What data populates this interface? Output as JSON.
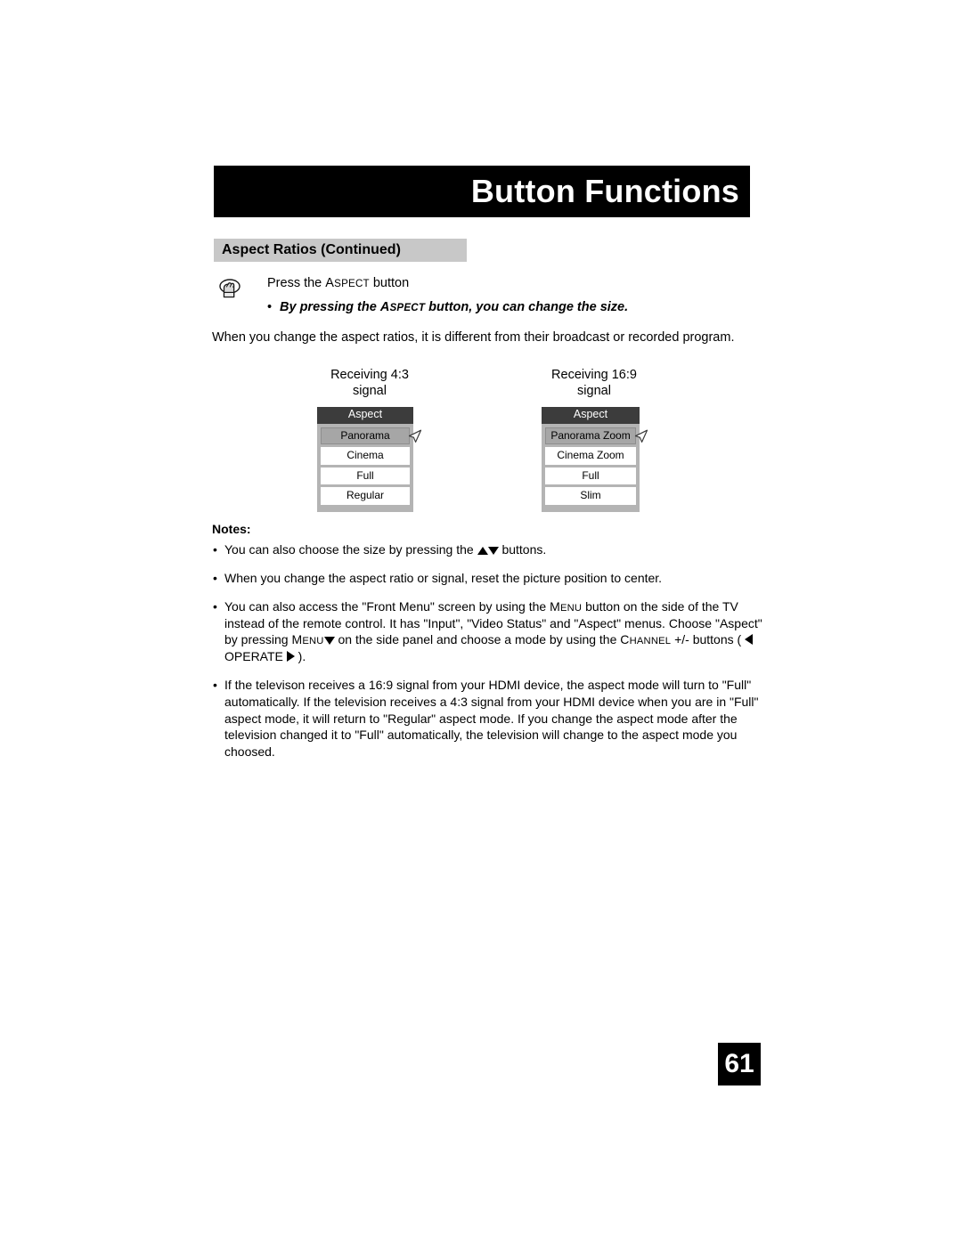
{
  "header": {
    "title": "Button Functions",
    "section_title": "Aspect Ratios (Continued)"
  },
  "press_block": {
    "icon": "pressing-hand-icon",
    "instruction_prefix": "Press the ",
    "instruction_button": "Aspect",
    "instruction_suffix": " button",
    "bullet_prefix": "By pressing the ",
    "bullet_button": "Aspect",
    "bullet_suffix": " button, you can change the size."
  },
  "intro_paragraph": "When you change the aspect ratios, it is different from their broadcast or recorded program.",
  "diagram": {
    "left": {
      "label_line1": "Receiving 4:3",
      "label_line2": "signal",
      "menu_title": "Aspect",
      "items": [
        "Panorama",
        "Cinema",
        "Full",
        "Regular"
      ],
      "selected": "Panorama",
      "cursor": "mouse-cursor-arrow"
    },
    "right": {
      "label_line1": "Receiving 16:9",
      "label_line2": "signal",
      "menu_title": "Aspect",
      "items": [
        "Panorama Zoom",
        "Cinema Zoom",
        "Full",
        "Slim"
      ],
      "selected": "Panorama Zoom",
      "cursor": "mouse-cursor-arrow"
    }
  },
  "notes": {
    "heading": "Notes:",
    "note1_pre": "You can also choose the size by pressing the ",
    "note1_post": " buttons.",
    "note2": "When you change the aspect ratio or signal, reset the picture position to center.",
    "note3_p1": "You can also access the \"Front Menu\" screen by using the ",
    "note3_menu1": "Menu",
    "note3_p2": " button on the side of the TV instead of the remote control.  It has \"Input\", \"Video Status\" and \"Aspect\" menus.  Choose \"Aspect\" by pressing ",
    "note3_menu2": "Menu",
    "note3_p3": " on the side panel and choose a mode by using the ",
    "note3_channel": "Channel",
    "note3_p4": " +/- buttons ( ",
    "note3_operate": " OPERATE ",
    "note3_p5": " ).",
    "note4": "If the televison receives a 16:9 signal from your HDMI device, the aspect mode will turn to \"Full\" automatically.  If the television receives a 4:3 signal from your HDMI device when you are in \"Full\" aspect mode, it will return to \"Regular\" aspect mode.  If you change the aspect mode after the television changed it to \"Full\" automatically, the television will change to the aspect mode you choosed."
  },
  "footer": {
    "page_number": "61"
  },
  "colors": {
    "header_bar": "#000000",
    "section_band": "#c8c8c8",
    "menu_title_bg": "#3c3c3c",
    "menu_frame": "#b4b4b4",
    "menu_selected": "#a6a6a6"
  }
}
